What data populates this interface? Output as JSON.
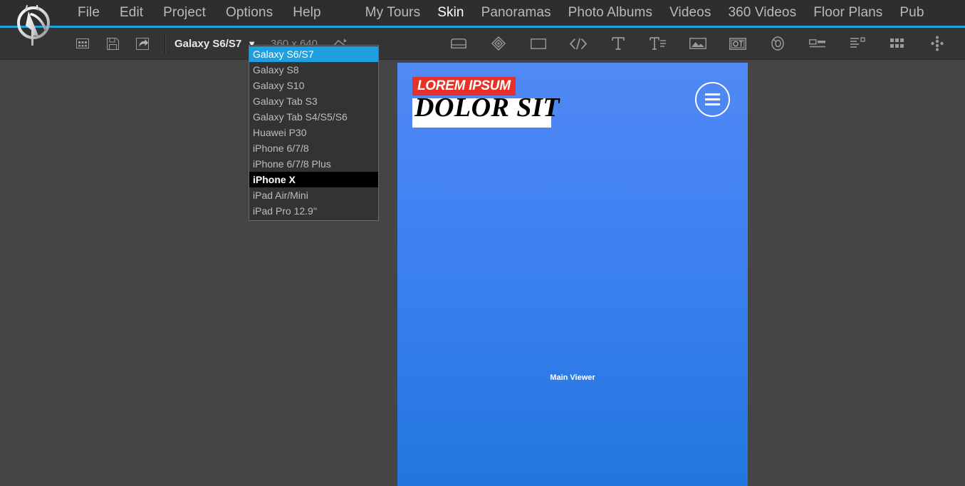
{
  "app": {
    "logo_name": "pano-studio-logo",
    "accent_color": "#1ca3e0",
    "menubar_bg": "#2e2e2e",
    "toolbar_bg": "#343434",
    "canvas_bg": "#454545"
  },
  "menubar": {
    "primary": [
      {
        "label": "File",
        "active": false
      },
      {
        "label": "Edit",
        "active": false
      },
      {
        "label": "Project",
        "active": false
      },
      {
        "label": "Options",
        "active": false
      },
      {
        "label": "Help",
        "active": false
      }
    ],
    "sections": [
      {
        "label": "My Tours",
        "active": false
      },
      {
        "label": "Skin",
        "active": true
      },
      {
        "label": "Panoramas",
        "active": false
      },
      {
        "label": "Photo Albums",
        "active": false
      },
      {
        "label": "Videos",
        "active": false
      },
      {
        "label": "360 Videos",
        "active": false
      },
      {
        "label": "Floor Plans",
        "active": false
      },
      {
        "label": "Pub",
        "active": false
      }
    ]
  },
  "toolbar": {
    "left_icons": [
      {
        "name": "grid-icon"
      },
      {
        "name": "save-icon"
      },
      {
        "name": "export-icon"
      }
    ],
    "device_selector": {
      "value": "Galaxy S6/S7",
      "caret": "▼"
    },
    "resolution": "360 x 640",
    "rotate_icon": "rotate-icon",
    "right_icons": [
      {
        "name": "container-icon"
      },
      {
        "name": "hotspot-icon"
      },
      {
        "name": "rectangle-icon"
      },
      {
        "name": "code-icon"
      },
      {
        "name": "text-icon"
      },
      {
        "name": "text-block-icon"
      },
      {
        "name": "image-icon"
      },
      {
        "name": "text-box-icon"
      },
      {
        "name": "compass-icon"
      },
      {
        "name": "scrollbar-icon"
      },
      {
        "name": "list-icon"
      },
      {
        "name": "thumbnails-icon"
      },
      {
        "name": "dots-icon"
      }
    ]
  },
  "device_dropdown": {
    "open": true,
    "selected_color": "#1e9fe0",
    "hover_color": "#000000",
    "items": [
      {
        "label": "Galaxy S6/S7",
        "state": "selected"
      },
      {
        "label": "Galaxy S8",
        "state": "normal"
      },
      {
        "label": "Galaxy S10",
        "state": "normal"
      },
      {
        "label": "Galaxy Tab S3",
        "state": "normal"
      },
      {
        "label": "Galaxy Tab S4/S5/S6",
        "state": "normal"
      },
      {
        "label": "Huawei P30",
        "state": "normal"
      },
      {
        "label": "iPhone 6/7/8",
        "state": "normal"
      },
      {
        "label": "iPhone 6/7/8 Plus",
        "state": "normal"
      },
      {
        "label": "iPhone X",
        "state": "hover"
      },
      {
        "label": "iPad Air/Mini",
        "state": "normal"
      },
      {
        "label": "iPad Pro 12.9''",
        "state": "normal"
      }
    ]
  },
  "preview": {
    "gradient_top": "#5189f5",
    "gradient_bottom": "#2176de",
    "badge": {
      "text": "LOREM IPSUM",
      "bg": "#e8302a",
      "color": "#ffffff"
    },
    "title": "DOLOR SIT",
    "menu_button": "hamburger-menu-icon",
    "viewer_label": "Main Viewer"
  }
}
